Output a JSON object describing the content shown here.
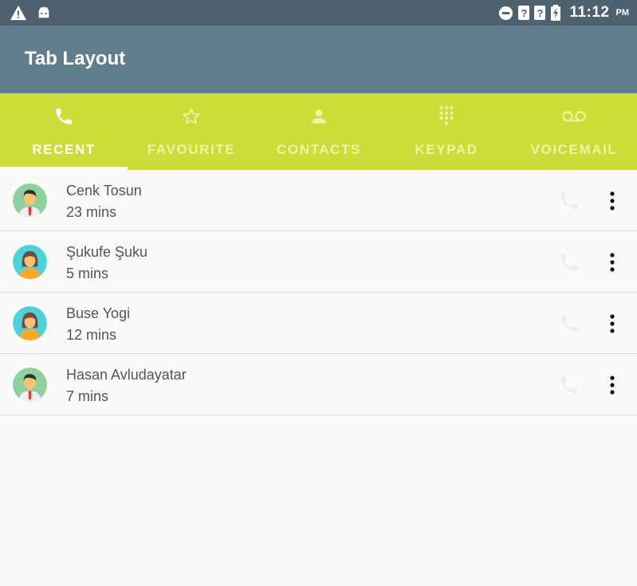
{
  "status_bar": {
    "time": "11:12",
    "ampm": "PM",
    "unknown_1": "?",
    "unknown_2": "?"
  },
  "app_bar": {
    "title": "Tab Layout"
  },
  "tabs": [
    {
      "label": "RECENT",
      "icon": "phone-icon",
      "active": true
    },
    {
      "label": "FAVOURITE",
      "icon": "star-icon",
      "active": false
    },
    {
      "label": "CONTACTS",
      "icon": "person-icon",
      "active": false
    },
    {
      "label": "KEYPAD",
      "icon": "dialpad-icon",
      "active": false
    },
    {
      "label": "VOICEMAIL",
      "icon": "voicemail-icon",
      "active": false
    }
  ],
  "contacts": [
    {
      "name": "Cenk Tosun",
      "time": "23 mins",
      "avatar": "male-avatar-icon"
    },
    {
      "name": "Şukufe Şuku",
      "time": "5 mins",
      "avatar": "female-avatar-icon"
    },
    {
      "name": "Buse Yogi",
      "time": "12 mins",
      "avatar": "female-avatar-icon"
    },
    {
      "name": "Hasan Avludayatar",
      "time": "7 mins",
      "avatar": "male-avatar-icon"
    }
  ],
  "colors": {
    "status_bar": "#4d626e",
    "app_bar": "#607d8b",
    "tab_bar": "#cddc39",
    "background": "#fafafa"
  }
}
